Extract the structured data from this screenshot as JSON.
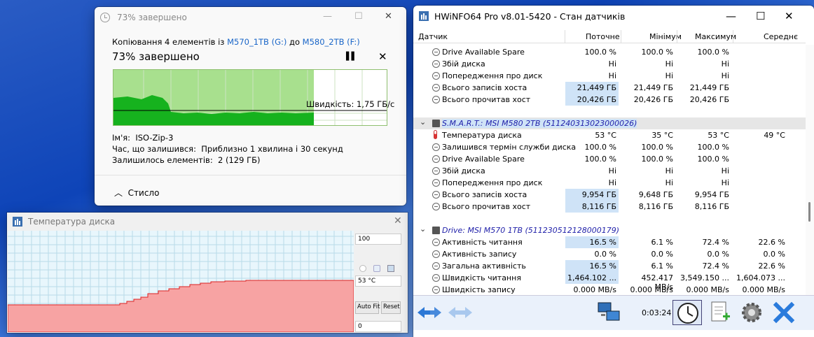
{
  "copy_dialog": {
    "title": "73% завершено",
    "line1_prefix": "Копіювання 4 елементів із ",
    "source": "M570_1TB (G:)",
    "to_word": " до ",
    "destination": "M580_2TB (F:)",
    "progress_text": "73% завершено",
    "progress": 0.73,
    "speed_text": "Швидкість: 1,75 ГБ/с",
    "name_label": "Ім'я:",
    "name_value": "ISO-Zip-3",
    "time_label": "Час, що залишився:",
    "time_value": "Приблизно 1 хвилина і 30 секунд",
    "items_label": "Залишилось елементів:",
    "items_value": "2 (129 ГБ)",
    "less_label": "Стисло",
    "accent": "#1a66c8",
    "graph_color": "#16b21e"
  },
  "temp_window": {
    "title": "Температура диска",
    "max_value": "100",
    "current_value": "53 °C",
    "min_value": "0",
    "autofit_label": "Auto Fit",
    "reset_label": "Reset",
    "fill_color": "#f7a3a3"
  },
  "hwinfo": {
    "title": "HWiNFO64 Pro v8.01-5420 - Стан датчиків",
    "columns": [
      "Датчик",
      "Поточне",
      "Мінімум",
      "Максимум",
      "Середнє"
    ],
    "rows": [
      {
        "type": "row",
        "name": "Drive Available Spare",
        "cur": "100.0 %",
        "min": "100.0 %",
        "max": "100.0 %",
        "avg": "",
        "hl": false
      },
      {
        "type": "row",
        "name": "Збій диска",
        "cur": "Ні",
        "min": "Ні",
        "max": "Ні",
        "avg": "",
        "hl": false
      },
      {
        "type": "row",
        "name": "Попередження про диск",
        "cur": "Ні",
        "min": "Ні",
        "max": "Ні",
        "avg": "",
        "hl": false
      },
      {
        "type": "row",
        "name": "Всього записів хоста",
        "cur": "21,449 ГБ",
        "min": "21,449 ГБ",
        "max": "21,449 ГБ",
        "avg": "",
        "hl": true
      },
      {
        "type": "row",
        "name": "Всього прочитав хост",
        "cur": "20,426 ГБ",
        "min": "20,426 ГБ",
        "max": "20,426 ГБ",
        "avg": "",
        "hl": true
      },
      {
        "type": "blank"
      },
      {
        "type": "group",
        "name": "S.M.A.R.T.: MSI M580 2TB (511240313023000026)",
        "selected": true
      },
      {
        "type": "row",
        "name": "Температура диска",
        "cur": "53 °C",
        "min": "35 °C",
        "max": "53 °C",
        "avg": "49 °C",
        "hl": false,
        "thermo": true
      },
      {
        "type": "row",
        "name": "Залишився термін служби диска",
        "cur": "100.0 %",
        "min": "100.0 %",
        "max": "100.0 %",
        "avg": "",
        "hl": false
      },
      {
        "type": "row",
        "name": "Drive Available Spare",
        "cur": "100.0 %",
        "min": "100.0 %",
        "max": "100.0 %",
        "avg": "",
        "hl": false
      },
      {
        "type": "row",
        "name": "Збій диска",
        "cur": "Ні",
        "min": "Ні",
        "max": "Ні",
        "avg": "",
        "hl": false
      },
      {
        "type": "row",
        "name": "Попередження про диск",
        "cur": "Ні",
        "min": "Ні",
        "max": "Ні",
        "avg": "",
        "hl": false
      },
      {
        "type": "row",
        "name": "Всього записів хоста",
        "cur": "9,954 ГБ",
        "min": "9,648 ГБ",
        "max": "9,954 ГБ",
        "avg": "",
        "hl": true
      },
      {
        "type": "row",
        "name": "Всього прочитав хост",
        "cur": "8,116 ГБ",
        "min": "8,116 ГБ",
        "max": "8,116 ГБ",
        "avg": "",
        "hl": true
      },
      {
        "type": "blank"
      },
      {
        "type": "group",
        "name": "Drive: MSI M570 1TB (511230512128000179)",
        "selected": false
      },
      {
        "type": "row",
        "name": "Активність читання",
        "cur": "16.5 %",
        "min": "6.1 %",
        "max": "72.4 %",
        "avg": "22.6 %",
        "hl": true
      },
      {
        "type": "row",
        "name": "Активність запису",
        "cur": "0.0 %",
        "min": "0.0 %",
        "max": "0.0 %",
        "avg": "0.0 %",
        "hl": false
      },
      {
        "type": "row",
        "name": "Загальна активність",
        "cur": "16.5 %",
        "min": "6.1 %",
        "max": "72.4 %",
        "avg": "22.6 %",
        "hl": true
      },
      {
        "type": "row",
        "name": "Швидкість читання",
        "cur": "1,464.102 ...",
        "min": "452.417 MB/s",
        "max": "3,549.150 ...",
        "avg": "1,604.073 ...",
        "hl": true
      },
      {
        "type": "row",
        "name": "Швидкість запису",
        "cur": "0.000 MB/s",
        "min": "0.000 MB/s",
        "max": "0.000 MB/s",
        "avg": "0.000 MB/s",
        "hl": false
      }
    ],
    "timer": "0:03:24",
    "selection_color": "#cfe3f7"
  }
}
